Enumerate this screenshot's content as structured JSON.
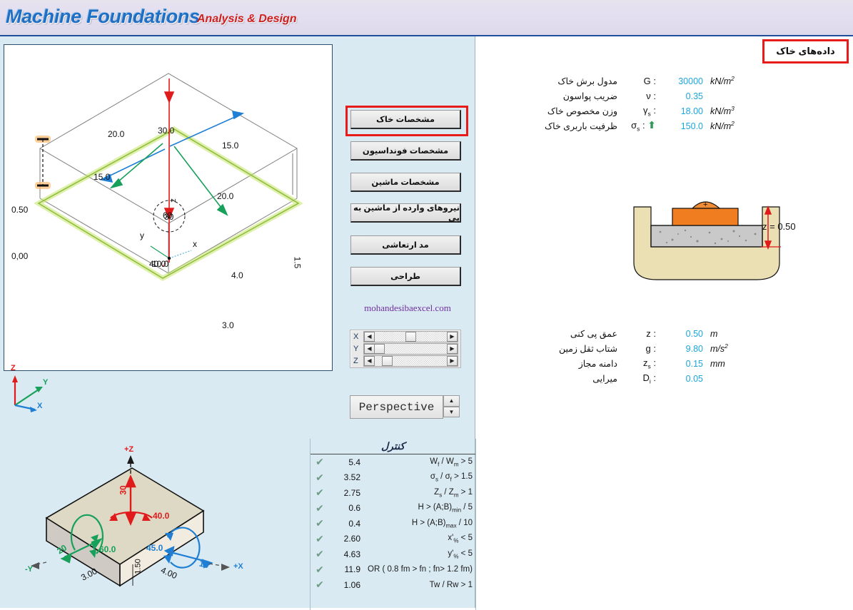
{
  "header": {
    "title_main": "Machine Foundations",
    "title_sub": "Analysis & Design"
  },
  "buttons": {
    "soil": "مشخصات خاک",
    "foundation": "مشخصات فونداسیون",
    "machine": "مشخصات ماشین",
    "forces": "نیروهای وارده از ماشین به پی",
    "vibration_mode": "مد ارتعاشی",
    "design": "طراحی",
    "site_link": "mohandesibaexcel.com"
  },
  "view_controls": {
    "axis_x": "X",
    "axis_y": "Y",
    "axis_z": "Z",
    "left_arrow": "◀",
    "right_arrow": "▶",
    "up_arrow": "▲",
    "down_arrow": "▼",
    "projection": "Perspective"
  },
  "drawing3d": {
    "dim_top_left": "20.0",
    "dim_top_mid": "30.0",
    "dim_top_right": "15.0",
    "dim_mid_left": "15.0",
    "dim_mid_right": "20.0",
    "moment_center_a": "60",
    "moment_center_b": "30",
    "dim_bottom_center_a": "40.0",
    "dim_bottom_center_b": "10.0",
    "elev_top": "0.50",
    "elev_bottom": "0,00",
    "dim_side_4": "4.0",
    "dim_side_3": "3.0",
    "dim_height": "1.5",
    "axis_x": "x",
    "axis_y": "y",
    "axis_z": "z",
    "triad_x": "X",
    "triad_y": "Y",
    "triad_z": "Z"
  },
  "soil_panel": {
    "title": "داده‌های خاک",
    "rows": [
      {
        "label": "مدول برش خاک",
        "symbol": "G :",
        "value": "30000",
        "unit": "kN/m",
        "unit_sup": "2",
        "arrow": false
      },
      {
        "label": "ضریب پواسون",
        "symbol": "ν :",
        "value": "0.35",
        "unit": "",
        "unit_sup": "",
        "arrow": false
      },
      {
        "label": "وزن مخصوص خاک",
        "symbol": "γs :",
        "value": "18.00",
        "unit": "kN/m",
        "unit_sup": "3",
        "arrow": false
      },
      {
        "label": "ظرفیت باربری خاک",
        "symbol": "σs :",
        "value": "150.0",
        "unit": "kN/m",
        "unit_sup": "2",
        "arrow": true
      }
    ],
    "rows2": [
      {
        "label": "عمق پی کنی",
        "symbol": "z :",
        "value": "0.50",
        "unit": "m",
        "unit_sup": ""
      },
      {
        "label": "شتاب ثقل زمین",
        "symbol": "g :",
        "value": "9.80",
        "unit": "m/s",
        "unit_sup": "2"
      },
      {
        "label": "دامنه مجاز",
        "symbol": "zs :",
        "value": "0.15",
        "unit": "mm",
        "unit_sup": ""
      },
      {
        "label": "میرایی",
        "symbol": "Di :",
        "value": "0.05",
        "unit": "",
        "unit_sup": ""
      }
    ]
  },
  "cross_section": {
    "depth_label": "z = 0.50",
    "machine_marker": "+"
  },
  "control_panel": {
    "title": "کنترل",
    "check_glyph": "✔",
    "rows": [
      {
        "value": "5.4",
        "criterion": "W<sub>f</sub> / W<sub>m</sub> > 5"
      },
      {
        "value": "3.52",
        "criterion": "σ<sub>s</sub> / σ<sub>f</sub> > 1.5"
      },
      {
        "value": "2.75",
        "criterion": "Z<sub>s</sub> / Z<sub>m</sub> > 1"
      },
      {
        "value": "0.6",
        "criterion": "H > (A;B)<sub>min</sub> / 5"
      },
      {
        "value": "0.4",
        "criterion": "H > (A;B)<sub>max</sub> / 10"
      },
      {
        "value": "2.60",
        "criterion": "x'<sub>%</sub> < 5"
      },
      {
        "value": "4.63",
        "criterion": "y'<sub>%</sub> < 5"
      },
      {
        "value": "11.9",
        "criterion": "OR ( 0.8 fm > fn ;  fn> 1.2 fm)"
      },
      {
        "value": "1.06",
        "criterion": "Tw / Rw > 1"
      }
    ]
  },
  "block_diagram": {
    "axis_pz": "+Z",
    "axis_px": "+X",
    "axis_ny": "-Y",
    "force_z": "30",
    "moment_z": "40.0",
    "force_y": "20",
    "moment_y": "60.0",
    "force_x": "15",
    "moment_x": "45.0",
    "dim_b": "3.00",
    "dim_a": "4.00",
    "dim_h": "1.50"
  },
  "colors": {
    "accent_blue": "#1f6fc4",
    "accent_red": "#cf2020",
    "value_blue": "#1ba6de",
    "panel_bg": "#daeaf2",
    "check_green": "#6e9b87",
    "highlight_red": "#e81b1b"
  }
}
